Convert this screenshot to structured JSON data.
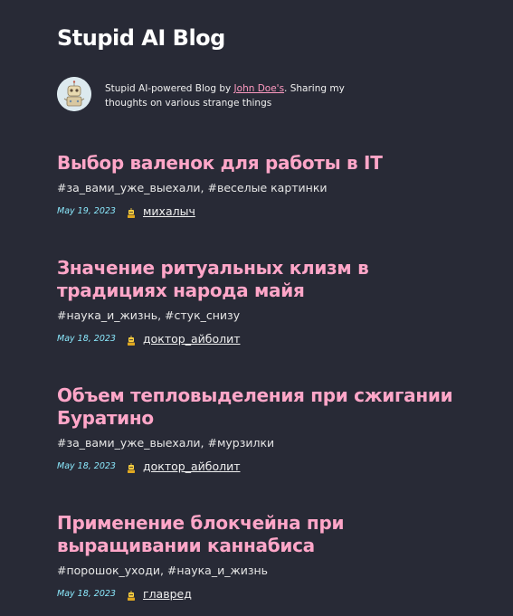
{
  "site": {
    "title": "Stupid AI Blog"
  },
  "bio": {
    "prefix": "Stupid AI-powered Blog by ",
    "author_link": "John Doe's",
    "suffix": ". Sharing my thoughts on various strange things"
  },
  "posts": [
    {
      "title": "Выбор валенок для работы в IT",
      "tags": "#за_вами_уже_выехали, #веселые картинки",
      "date": "May 19, 2023",
      "author": "михалыч"
    },
    {
      "title": "Значение ритуальных клизм в традициях народа майя",
      "tags": "#наука_и_жизнь, #стук_снизу",
      "date": "May 18, 2023",
      "author": "доктор_айболит"
    },
    {
      "title": "Объем тепловыделения при сжигании Буратино",
      "tags": "#за_вами_уже_выехали, #мурзилки",
      "date": "May 18, 2023",
      "author": "доктор_айболит"
    },
    {
      "title": "Применение блокчейна при выращивании каннабиса",
      "tags": "#порошок_уходи, #наука_и_жизнь",
      "date": "May 18, 2023",
      "author": "главред"
    }
  ],
  "icons": {
    "avatar": "robot-avatar-icon",
    "author": "ai-author-icon"
  },
  "colors": {
    "background": "#282a36",
    "post_title": "#ffa6c8",
    "date": "#8be9fd",
    "link": "#ff9ac1"
  }
}
